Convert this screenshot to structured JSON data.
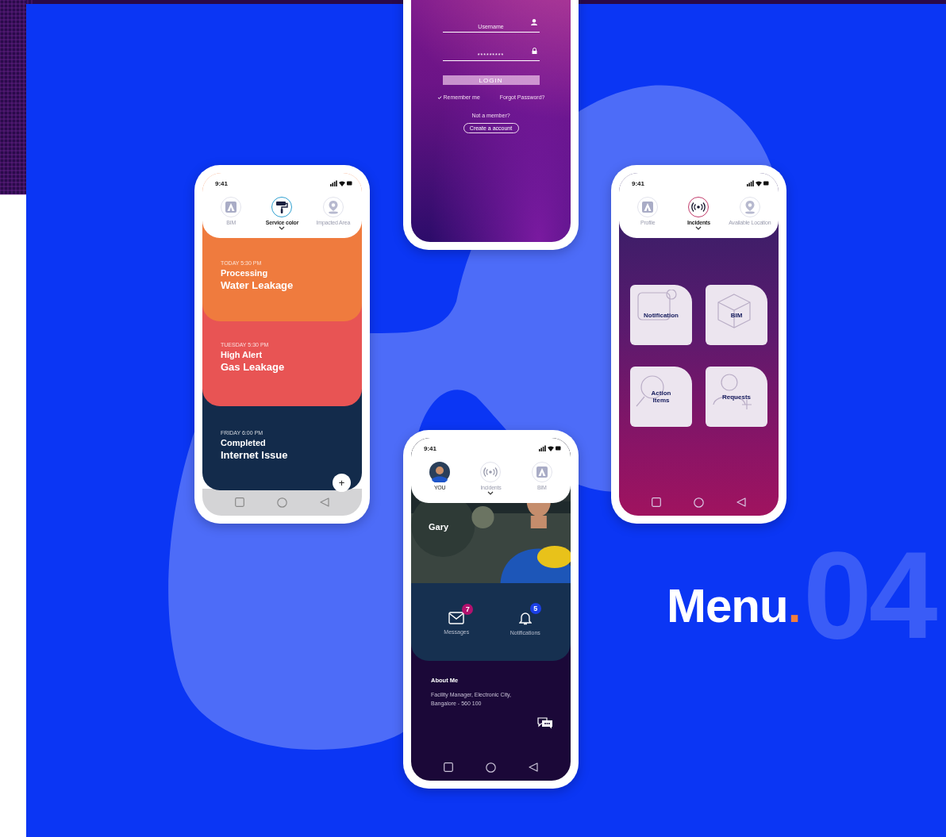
{
  "screens": [
    {
      "kind": "login",
      "username": {
        "placeholder": "Username"
      },
      "password": {
        "value": "*********"
      },
      "login_button": "LOGIN",
      "remember": {
        "label": "Remember me",
        "checked": true
      },
      "forgot": "Forgot Password?",
      "not_member": "Not a member?",
      "create_button": "Create a account"
    },
    {
      "kind": "incidents",
      "time": "9:41",
      "tabs": [
        {
          "kind": "bim",
          "label": "BIM",
          "selected": false
        },
        {
          "kind": "roller",
          "label": "Service color",
          "selected": true
        },
        {
          "kind": "pin",
          "label": "Impacted Area",
          "selected": false
        }
      ],
      "cards": [
        {
          "date": "TODAY 5:30 PM",
          "status": "Processing",
          "title": "Water Leakage",
          "color": "#ef7b3e"
        },
        {
          "date": "TUESDAY 5:30 PM",
          "status": "High Alert",
          "title": "Gas Leakage",
          "color": "#e85454"
        },
        {
          "date": "FRIDAY 6:00 PM",
          "status": "Completed",
          "title": "Internet Issue",
          "color": "#132b4b"
        }
      ],
      "fab": "+"
    },
    {
      "kind": "menu",
      "time": "9:41",
      "tabs": [
        {
          "kind": "bim",
          "label": "Profile",
          "selected": false
        },
        {
          "kind": "signal",
          "label": "Incidents",
          "selected": true
        },
        {
          "kind": "pin",
          "label": "Available Location",
          "selected": false
        }
      ],
      "tiles": [
        {
          "kind": "bell",
          "label": "Notification"
        },
        {
          "kind": "cube",
          "label": "BIM"
        },
        {
          "kind": "search",
          "label": "Action Items"
        },
        {
          "kind": "person",
          "label": "Requests"
        }
      ]
    },
    {
      "kind": "profile",
      "time": "9:41",
      "tabs": [
        {
          "kind": "avatar",
          "label": "YOU",
          "selected": false
        },
        {
          "kind": "signal",
          "label": "Incidents",
          "selected": true
        },
        {
          "kind": "bim",
          "label": "BIM",
          "selected": false
        }
      ],
      "name": "Gary",
      "stats": [
        {
          "kind": "mail",
          "label": "Messages",
          "count": "7",
          "color": "#b3116e"
        },
        {
          "kind": "bell",
          "label": "Notifications",
          "count": "5",
          "color": "#1b3fe6"
        }
      ],
      "about_title": "About Me",
      "about_text": "Facility  Manager, Electronic City, Bangalore - 560 100"
    }
  ],
  "title": {
    "word": "Menu",
    "dot": ".",
    "number": "04"
  }
}
